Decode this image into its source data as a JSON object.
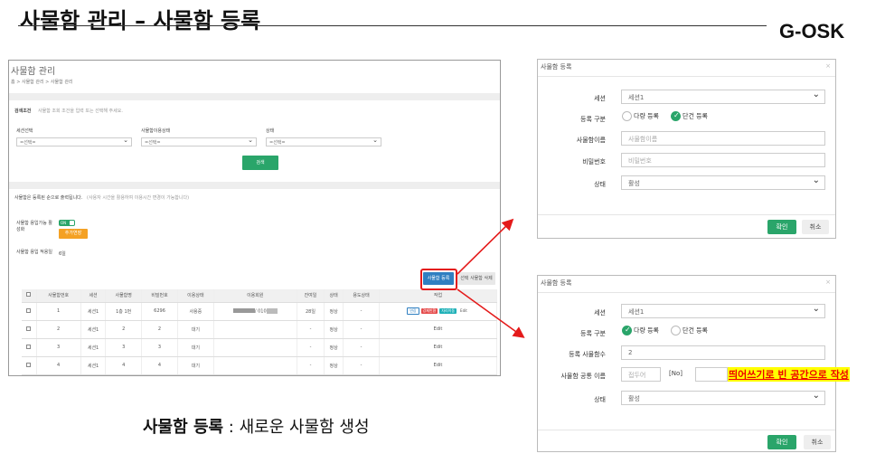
{
  "slide": {
    "title": "사물함 관리 – 사물함 등록",
    "brand": "G-OSK",
    "caption_bold": "사물함 등록",
    "caption_rest": " : 새로운 사물함 생성"
  },
  "main": {
    "title": "사물함 관리",
    "breadcrumb": "홈 > 사물함 관리 > 사물함 관리",
    "search_heading": "검색조건",
    "search_hint": "사물함 조회 조건을 입력 또는 선택해 주세요.",
    "filters": [
      {
        "label": "세션선택",
        "value": "=선택="
      },
      {
        "label": "사물함이용상태",
        "value": "=선택="
      },
      {
        "label": "상태",
        "value": "=선택="
      }
    ],
    "search_button": "검색",
    "info_heading": "사물함은 등록된 순으로 출력됩니다.",
    "info_hint": "(사용자 시간을 활용하여 이용시간 변경이 가능합니다)",
    "usage_toggle_label": "사물함 용입가능 활성화",
    "toggle_text": "ON",
    "extend_button": "추가연장",
    "usage_days_label": "사물함 용입 적용일",
    "usage_days_value": "6일",
    "register_button": "사물함 등록",
    "delete_button": "선택 사물함 삭제",
    "columns": [
      "",
      "사물함번호",
      "세션",
      "사물함명",
      "비밀번호",
      "이용상태",
      "이용회원",
      "잔여일",
      "상태",
      "용도상태",
      "작업"
    ],
    "rows": [
      {
        "no": "1",
        "session": "세션1",
        "name": "1층 1번",
        "pw": "6296",
        "use": "사용중",
        "member": "/ 010",
        "remain": "28일",
        "status": "정상",
        "purpose": "-",
        "actions": [
          "연장",
          "강제반환",
          "자리이동",
          "Edit"
        ]
      },
      {
        "no": "2",
        "session": "세션1",
        "name": "2",
        "pw": "2",
        "use": "대기",
        "member": "",
        "remain": "-",
        "status": "정상",
        "purpose": "-",
        "actions": [
          "Edit"
        ]
      },
      {
        "no": "3",
        "session": "세션1",
        "name": "3",
        "pw": "3",
        "use": "대기",
        "member": "",
        "remain": "-",
        "status": "정상",
        "purpose": "-",
        "actions": [
          "Edit"
        ]
      },
      {
        "no": "4",
        "session": "세션1",
        "name": "4",
        "pw": "4",
        "use": "대기",
        "member": "",
        "remain": "-",
        "status": "정상",
        "purpose": "-",
        "actions": [
          "Edit"
        ]
      }
    ]
  },
  "modal_single": {
    "title": "사물함 등록",
    "session_label": "세션",
    "session_value": "세션1",
    "type_label": "등록 구분",
    "type_multi": "다량 등록",
    "type_single": "단건 등록",
    "name_label": "사물함이름",
    "name_placeholder": "사물함이름",
    "pw_label": "비밀번호",
    "pw_placeholder": "비밀번호",
    "status_label": "상태",
    "status_value": "활성",
    "ok": "확인",
    "cancel": "취소"
  },
  "modal_multi": {
    "title": "사물함 등록",
    "session_label": "세션",
    "session_value": "세션1",
    "type_label": "등록 구분",
    "type_multi": "다량 등록",
    "type_single": "단건 등록",
    "count_label": "등록 사물함수",
    "count_value": "2",
    "common_name_label": "사물함 공통 이름",
    "prefix_placeholder": "접두어",
    "no_token": "[No]",
    "status_label": "상태",
    "status_value": "활성",
    "ok": "확인",
    "cancel": "취소",
    "note": "띄어쓰기로 빈 공간으로 작성"
  },
  "colors": {
    "accent": "#2aa56a",
    "annotation": "#e41a1a",
    "highlight": "#ffff00"
  }
}
